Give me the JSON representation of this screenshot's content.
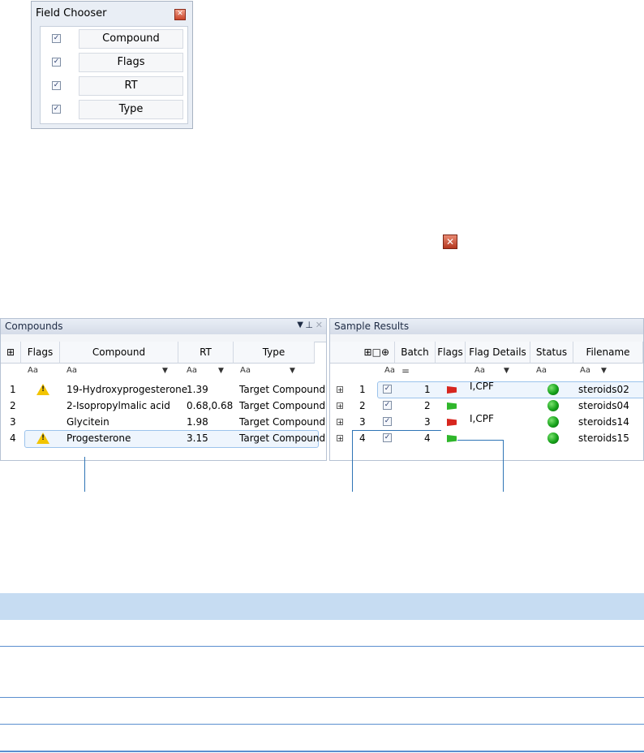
{
  "field_chooser": {
    "title": "Field Chooser",
    "close_icon": "close-icon",
    "fields": [
      {
        "label": "Compound",
        "checked": true
      },
      {
        "label": "Flags",
        "checked": true
      },
      {
        "label": "RT",
        "checked": true
      },
      {
        "label": "Type",
        "checked": true
      }
    ]
  },
  "compounds_panel": {
    "title": "Compounds",
    "pin_icon": "pin-icon",
    "columns": [
      "Flags",
      "Compound",
      "RT",
      "Type"
    ],
    "filter_text": "Aa",
    "rows": [
      {
        "num": "1",
        "warning": true,
        "compound": "19-Hydroxyprogesterone",
        "rt": "1.39",
        "type": "Target Compound"
      },
      {
        "num": "2",
        "warning": false,
        "compound": "2-Isopropylmalic acid",
        "rt": "0.68,0.68",
        "type": "Target Compound"
      },
      {
        "num": "3",
        "warning": false,
        "compound": "Glycitein",
        "rt": "1.98",
        "type": "Target Compound"
      },
      {
        "num": "4",
        "warning": true,
        "compound": "Progesterone",
        "rt": "3.15",
        "type": "Target Compound"
      }
    ]
  },
  "sample_panel": {
    "title": "Sample Results",
    "columns": [
      "Batch",
      "Flags",
      "Flag Details",
      "Status",
      "Filename"
    ],
    "filter_text": "Aa",
    "filter_equals": "=",
    "rows": [
      {
        "num": "1",
        "checked": true,
        "batch": "1",
        "flag": "red",
        "details": "I,CPF",
        "status": "green",
        "filename": "steroids02"
      },
      {
        "num": "2",
        "checked": true,
        "batch": "2",
        "flag": "green",
        "details": "",
        "status": "green",
        "filename": "steroids04"
      },
      {
        "num": "3",
        "checked": true,
        "batch": "3",
        "flag": "red",
        "details": "I,CPF",
        "status": "green",
        "filename": "steroids14"
      },
      {
        "num": "4",
        "checked": true,
        "batch": "4",
        "flag": "green",
        "details": "",
        "status": "green",
        "filename": "steroids15"
      }
    ]
  },
  "colors": {
    "accent": "#2e74b5",
    "table_header": "#c6dcf2",
    "flag_red": "#d7261e",
    "flag_green": "#2fb62b"
  }
}
